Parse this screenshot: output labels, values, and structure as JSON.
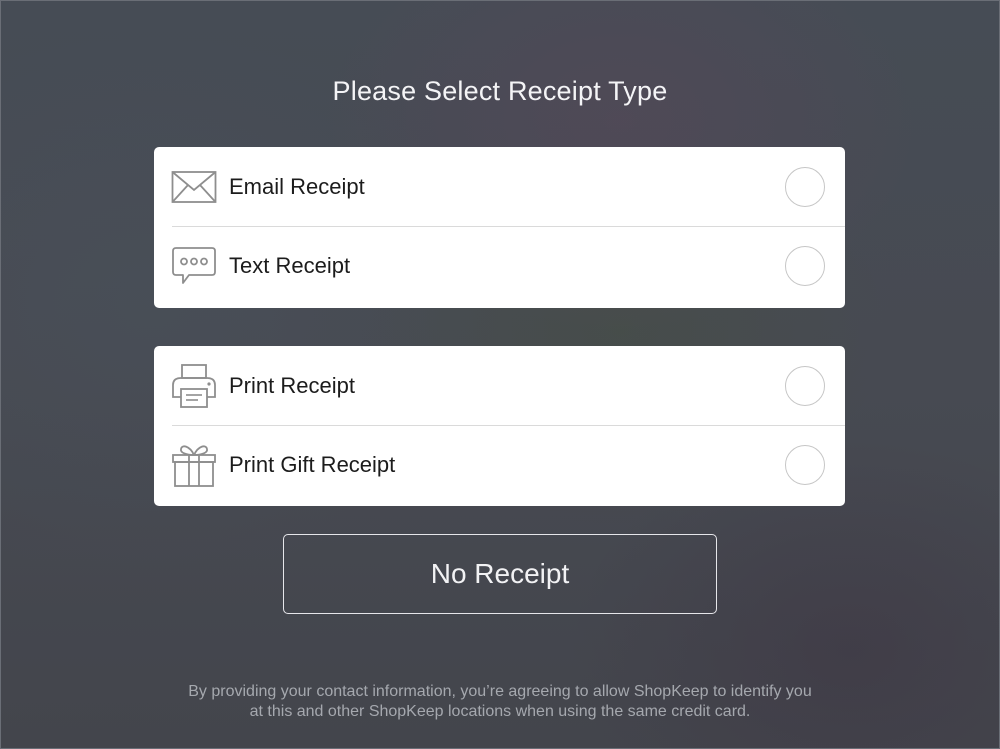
{
  "page": {
    "title": "Please Select Receipt Type"
  },
  "digital_options": [
    {
      "label": "Email Receipt",
      "icon": "envelope-icon",
      "selected": false
    },
    {
      "label": "Text Receipt",
      "icon": "chat-bubble-icon",
      "selected": false
    }
  ],
  "print_options": [
    {
      "label": "Print Receipt",
      "icon": "printer-icon",
      "selected": false
    },
    {
      "label": "Print Gift Receipt",
      "icon": "gift-icon",
      "selected": false
    }
  ],
  "no_receipt_button": {
    "label": "No Receipt"
  },
  "disclaimer": {
    "line1": "By providing your contact information, you’re agreeing to allow ShopKeep to identify you",
    "line2": "at this and other ShopKeep locations when using the same credit card."
  },
  "colors": {
    "card_background": "#ffffff",
    "radio_border": "#c6c6c6",
    "icon_stroke": "#8e8e8e",
    "title_text": "#f4f4f6",
    "disclaimer_text": "#a5a8ae"
  }
}
